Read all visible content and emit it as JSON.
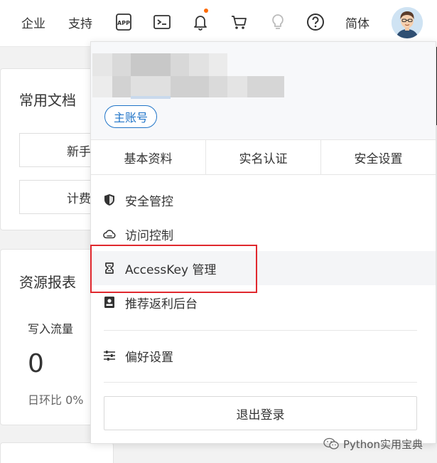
{
  "topbar": {
    "items": {
      "enterprise": "企业",
      "support": "支持",
      "language": "简体"
    },
    "icons": [
      "app-icon",
      "terminal-icon",
      "bell-icon",
      "cart-icon",
      "lightbulb-icon",
      "help-icon"
    ],
    "notify_color": "#ff6a00"
  },
  "background": {
    "docs_title": "常用文档",
    "docs_btn_1": "新手",
    "docs_btn_2": "计费",
    "reports_title": "资源报表",
    "metric_label": "写入流量",
    "metric_value": "0",
    "metric_sub": "日环比 0%"
  },
  "dropdown": {
    "account_badge": "主账号",
    "tabs": [
      "基本资料",
      "实名认证",
      "安全设置"
    ],
    "menu": [
      {
        "label": "安全管控",
        "icon": "shield-icon"
      },
      {
        "label": "访问控制",
        "icon": "cloud-icon"
      },
      {
        "label": "AccessKey 管理",
        "icon": "accesskey-icon"
      },
      {
        "label": "推荐返利后台",
        "icon": "rebate-icon"
      },
      {
        "label": "偏好设置",
        "icon": "sliders-icon"
      }
    ],
    "logout": "退出登录"
  },
  "accent_color": "#1f74c8",
  "highlight_color": "#e0282e",
  "watermark": "Python实用宝典"
}
